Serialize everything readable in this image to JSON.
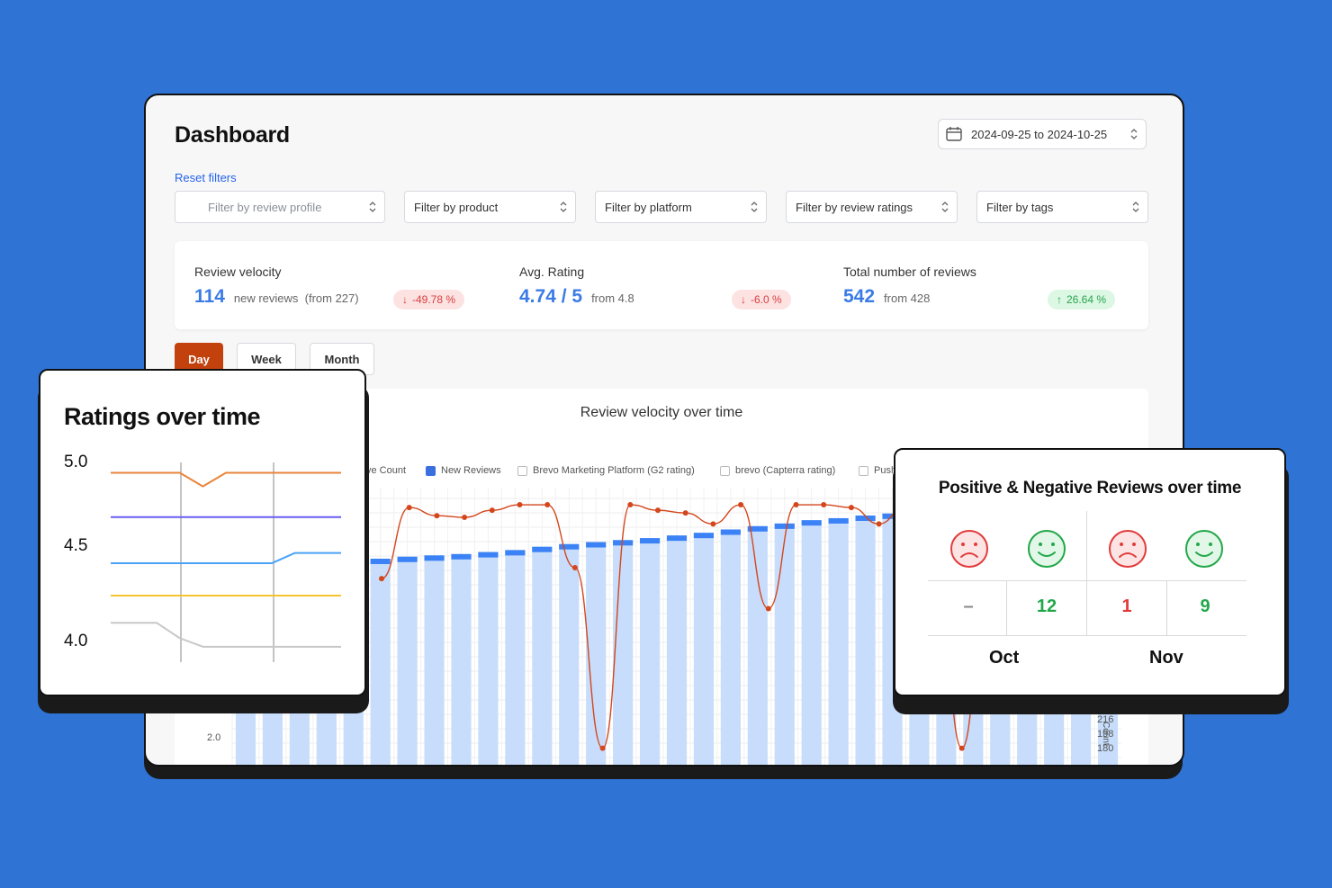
{
  "dashboard": {
    "title": "Dashboard",
    "date_range": "2024-09-25 to 2024-10-25",
    "reset_filters": "Reset filters",
    "filters": [
      {
        "label": "Filter by review profile",
        "placeholder": true
      },
      {
        "label": "Filter by product",
        "placeholder": false
      },
      {
        "label": "Filter by platform",
        "placeholder": false
      },
      {
        "label": "Filter by review ratings",
        "placeholder": false
      },
      {
        "label": "Filter by tags",
        "placeholder": false
      }
    ],
    "stats": [
      {
        "label": "Review velocity",
        "value": "114",
        "detail": "new reviews  (from 227)",
        "change": "-49.78 %",
        "trend": "down"
      },
      {
        "label": "Avg. Rating",
        "value": "4.74 / 5",
        "detail": "from 4.8",
        "change": "-6.0 %",
        "trend": "down"
      },
      {
        "label": "Total number of reviews",
        "value": "542",
        "detail": "from 428",
        "change": "26.64 %",
        "trend": "up"
      }
    ],
    "tabs": [
      "Day",
      "Week",
      "Month"
    ],
    "active_tab": "Day",
    "chart": {
      "title": "Review velocity over time",
      "legend": [
        {
          "label": "ve Count",
          "checked": false
        },
        {
          "label": "New Reviews",
          "checked": true
        },
        {
          "label": "Brevo Marketing Platform (G2 rating)",
          "checked": false
        },
        {
          "label": "brevo (Capterra rating)",
          "checked": false
        },
        {
          "label": "Push",
          "checked": false
        }
      ],
      "left_tick": "2.0",
      "right_ticks": [
        "216",
        "198",
        "180"
      ],
      "right_axis_label": "Count"
    }
  },
  "ratings_card": {
    "title": "Ratings over time",
    "y_ticks": [
      "5.0",
      "4.5",
      "4.0"
    ]
  },
  "sentiment_card": {
    "title": "Positive & Negative Reviews over time",
    "months": [
      {
        "label": "Oct",
        "negative": "–",
        "positive": "12"
      },
      {
        "label": "Nov",
        "negative": "1",
        "positive": "9"
      }
    ]
  },
  "colors": {
    "background": "#2f73d4",
    "accent": "#c2410c",
    "bar": "#c7ddfb",
    "bar_top": "#3b82f6",
    "line": "#d4461c",
    "negative": "#e23b3b",
    "positive": "#22a84a"
  },
  "chart_data": [
    {
      "type": "line",
      "title": "Ratings over time",
      "ylim": [
        3.9,
        5.05
      ],
      "x": [
        0,
        1,
        2,
        3,
        4,
        5,
        6,
        7,
        8,
        9,
        10
      ],
      "series": [
        {
          "color": "#e8843a",
          "values": [
            5.0,
            5.0,
            5.0,
            5.0,
            4.92,
            5.0,
            5.0,
            5.0,
            5.0,
            5.0,
            5.0
          ]
        },
        {
          "color": "#6a5cf0",
          "values": [
            4.74,
            4.74,
            4.74,
            4.74,
            4.74,
            4.74,
            4.74,
            4.74,
            4.74,
            4.74,
            4.74
          ]
        },
        {
          "color": "#4aa3f5",
          "values": [
            4.47,
            4.47,
            4.47,
            4.47,
            4.47,
            4.47,
            4.47,
            4.47,
            4.53,
            4.53,
            4.53
          ]
        },
        {
          "color": "#f4c430",
          "values": [
            4.28,
            4.28,
            4.28,
            4.28,
            4.28,
            4.28,
            4.28,
            4.28,
            4.28,
            4.28,
            4.28
          ]
        },
        {
          "color": "#c8c8c8",
          "values": [
            4.12,
            4.12,
            4.12,
            4.03,
            3.98,
            3.98,
            3.98,
            3.98,
            3.98,
            3.98,
            3.98
          ]
        }
      ]
    },
    {
      "type": "bar",
      "title": "Review velocity over time",
      "y_right_ticks": [
        216,
        198,
        180
      ],
      "series": [
        {
          "name": "New Reviews",
          "type": "bar",
          "values": [
            300,
            302,
            305,
            308,
            311,
            313,
            316,
            318,
            320,
            323,
            326,
            331,
            335,
            338,
            341,
            344,
            348,
            352,
            357,
            362,
            366,
            371,
            374,
            378,
            381,
            384,
            387,
            390,
            393,
            396,
            399,
            402,
            405
          ]
        },
        {
          "type": "line",
          "values": [
            3.6,
            4.9,
            4.75,
            4.72,
            4.85,
            4.95,
            4.95,
            3.8,
            0.5,
            4.95,
            4.85,
            4.8,
            4.6,
            4.95,
            3.05,
            4.95,
            4.95,
            4.9,
            4.6,
            4.95,
            4.6,
            0.5,
            4.3,
            4.4
          ]
        }
      ]
    }
  ]
}
